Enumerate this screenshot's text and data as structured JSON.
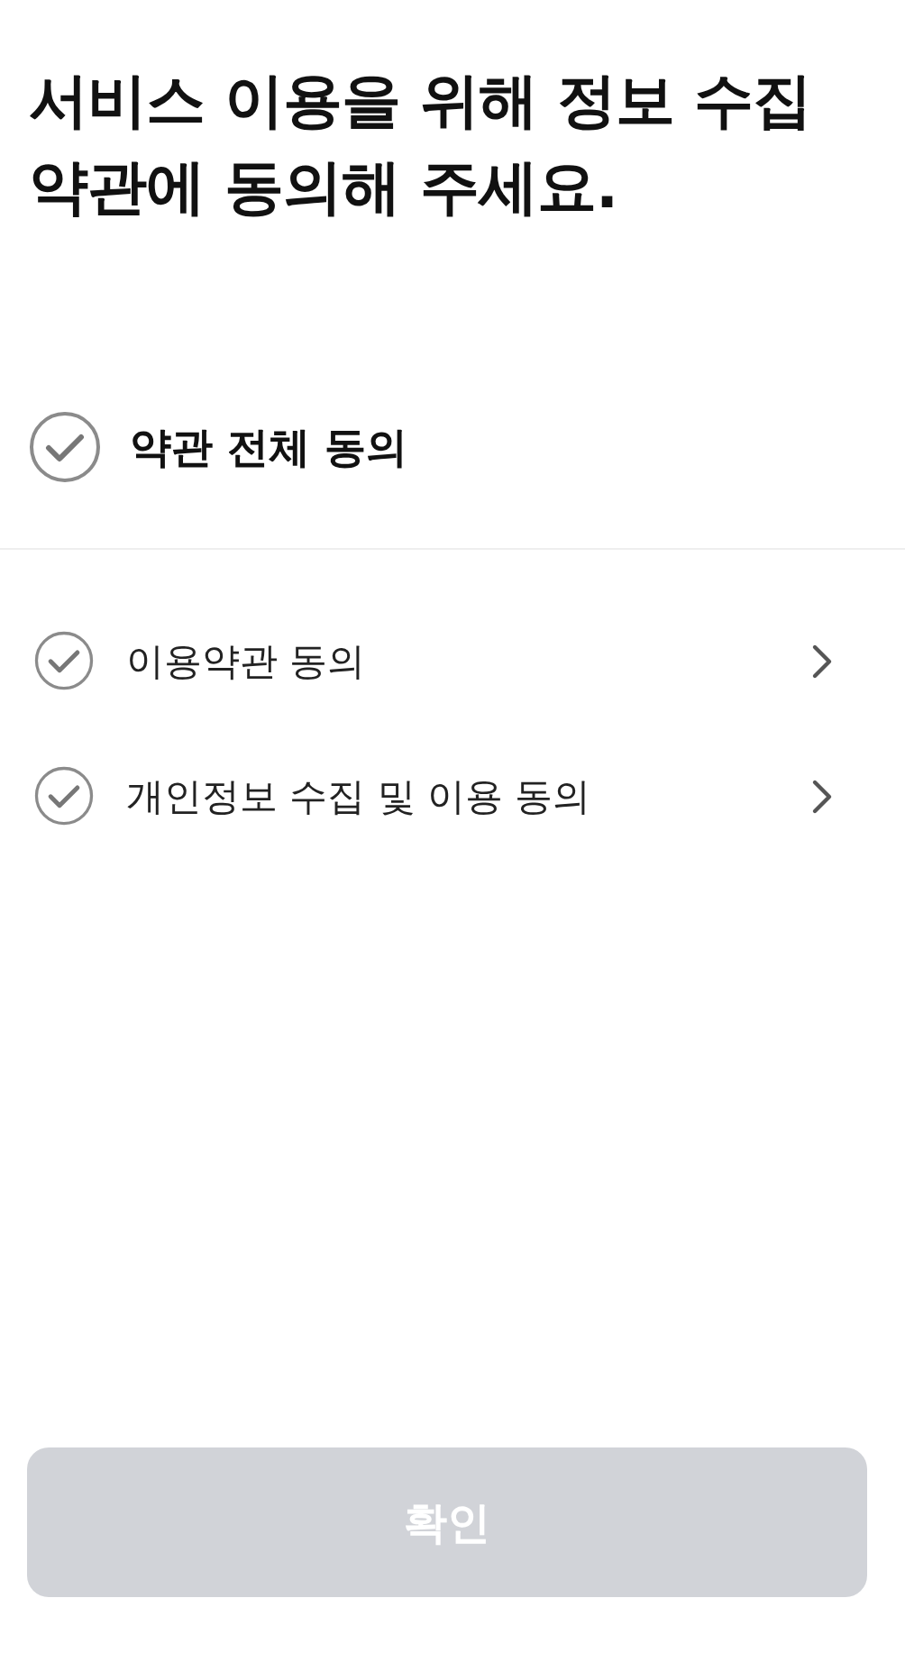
{
  "title": "서비스 이용을 위해 정보 수집\n약관에 동의해 주세요.",
  "agree_all": {
    "label": "약관 전체 동의",
    "checked": false
  },
  "terms": [
    {
      "label": "이용약관 동의",
      "checked": false
    },
    {
      "label": "개인정보 수집 및 이용 동의",
      "checked": false
    }
  ],
  "confirm_button": {
    "label": "확인",
    "disabled": true
  }
}
